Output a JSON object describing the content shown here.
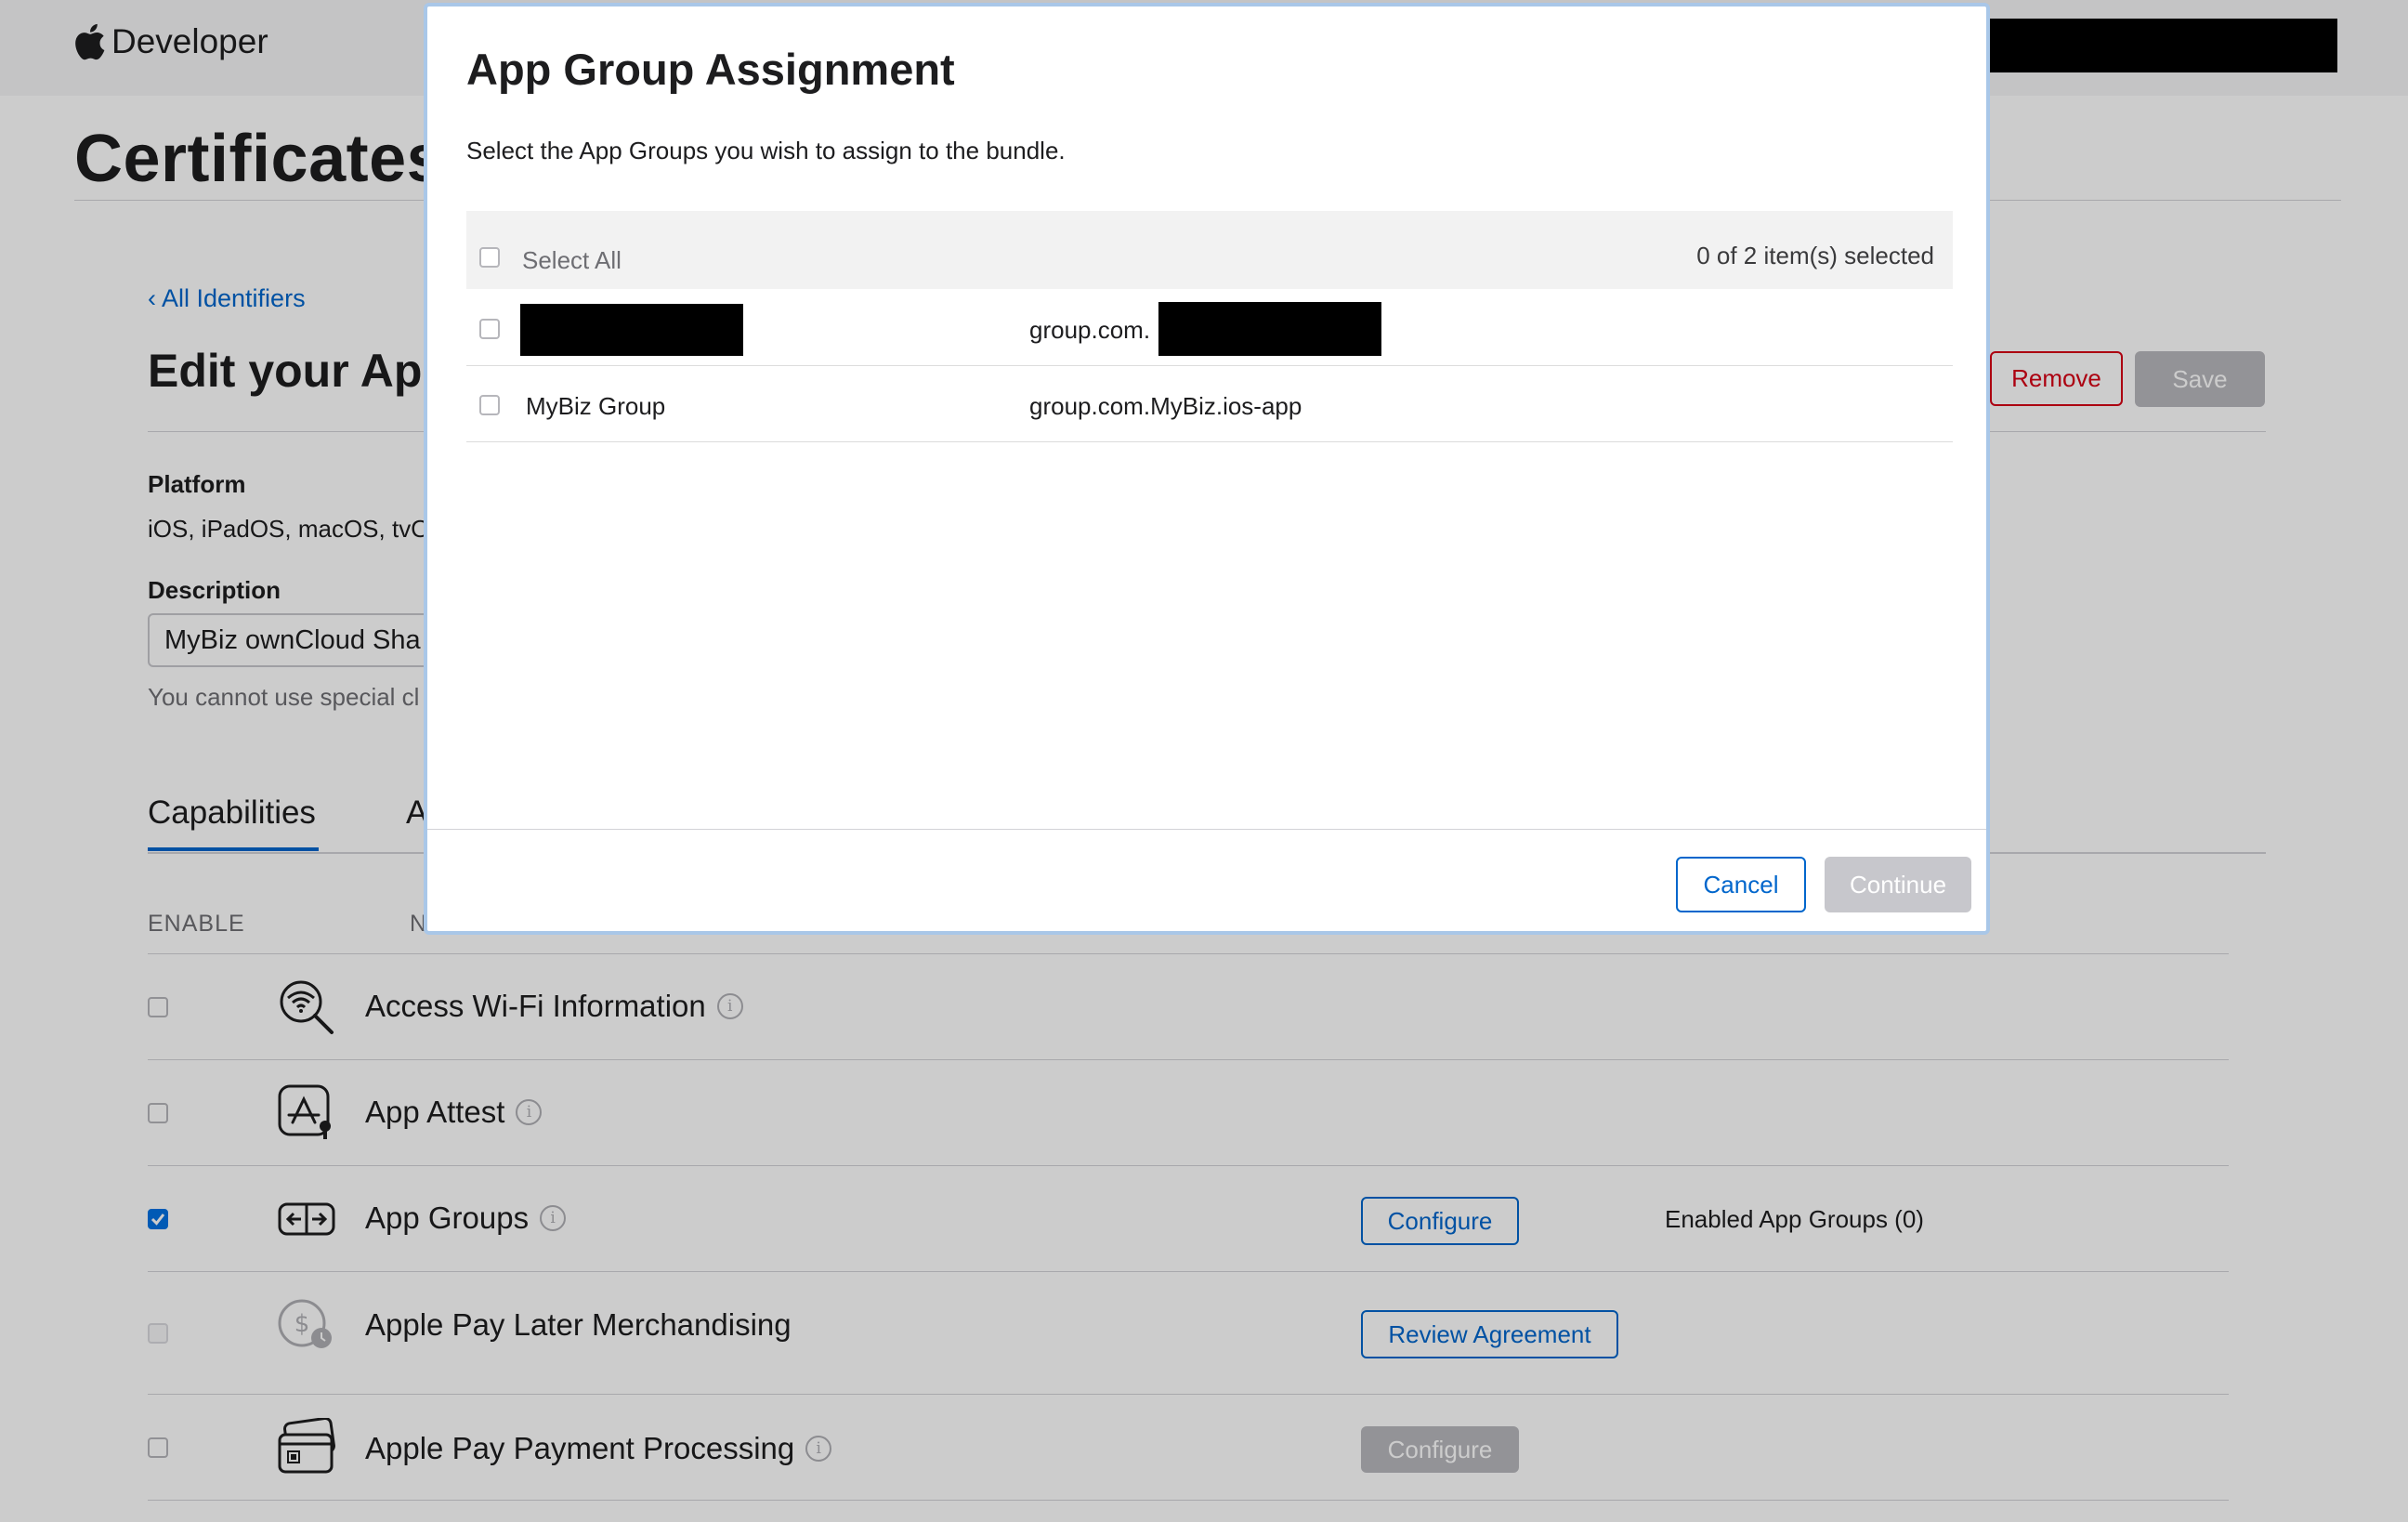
{
  "header": {
    "brand": "Developer"
  },
  "page": {
    "title": "Certificates",
    "back_link": "‹ All Identifiers",
    "edit_title": "Edit your App",
    "remove_label": "Remove",
    "save_label": "Save",
    "platform_label": "Platform",
    "platform_value": "iOS, iPadOS, macOS, tvO",
    "description_label": "Description",
    "description_value": "MyBiz ownCloud Sha",
    "description_helper": "You cannot use special cl",
    "tab_capabilities": "Capabilities",
    "tab_other": "A",
    "col_enable": "ENABLE",
    "col_name": "N"
  },
  "capabilities": [
    {
      "name": "Access Wi-Fi Information",
      "checked": false,
      "icon": "wifi-search-icon",
      "info": "i"
    },
    {
      "name": "App Attest",
      "checked": false,
      "icon": "app-attest-icon",
      "info": "i"
    },
    {
      "name": "App Groups",
      "checked": true,
      "icon": "app-groups-icon",
      "info": "i",
      "button": "Configure",
      "extra": "Enabled App Groups (0)"
    },
    {
      "name": "Apple Pay Later Merchandising",
      "checked": false,
      "icon": "apple-pay-later-icon",
      "button": "Review Agreement"
    },
    {
      "name": "Apple Pay Payment Processing",
      "checked": false,
      "icon": "apple-pay-card-icon",
      "info": "i",
      "button": "Configure"
    }
  ],
  "modal": {
    "title": "App Group Assignment",
    "subtitle": "Select the App Groups you wish to assign to the bundle.",
    "select_all": "Select All",
    "count": "0 of 2 item(s) selected",
    "rows": [
      {
        "name": "",
        "id": "group.com."
      },
      {
        "name": "MyBiz Group",
        "id": "group.com.MyBiz.ios-app"
      }
    ],
    "cancel_label": "Cancel",
    "continue_label": "Continue"
  },
  "colors": {
    "accent": "#0066cc",
    "danger": "#d70015",
    "checked": "#0071e3"
  }
}
